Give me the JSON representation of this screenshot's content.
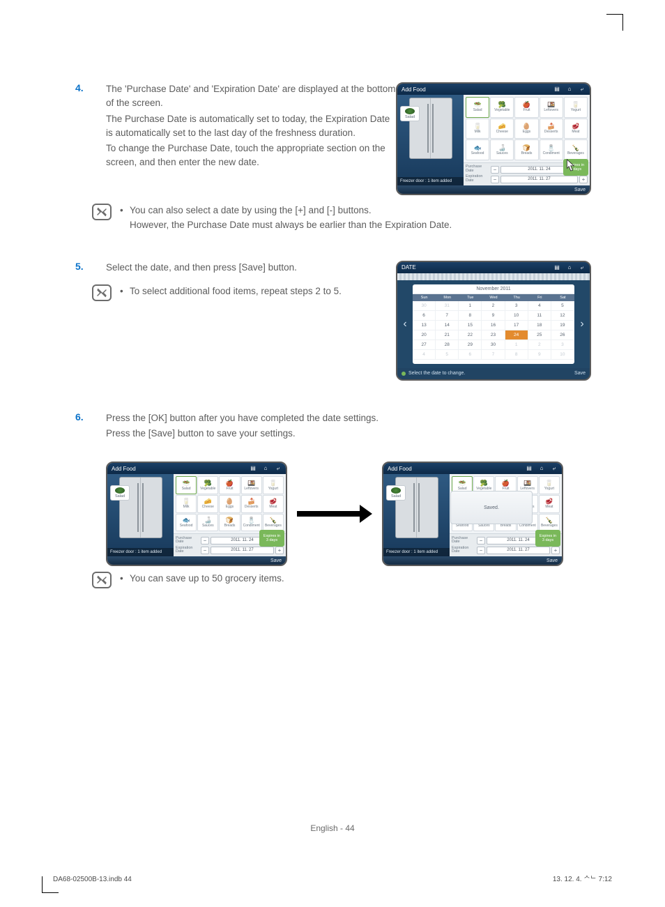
{
  "steps": {
    "s4_num": "4.",
    "s4_p1": "The 'Purchase Date' and 'Expiration Date' are displayed at the bottom of the screen.",
    "s4_p2": "The Purchase Date is automatically set to today, the Expiration Date is automatically set to the last day of the freshness duration.",
    "s4_p3": "To change the Purchase Date, touch the appropriate section on the screen, and then enter the new date.",
    "s5_num": "5.",
    "s5_p1": "Select the date, and then press [Save] button.",
    "s5_note": "To select additional food items, repeat steps 2 to 5.",
    "s6_num": "6.",
    "s6_p1": "Press the [OK] button after you have completed the date settings.",
    "s6_p2": "Press the [Save] button to save your settings."
  },
  "notes": {
    "after4_l1": "You can also select a date by using the [+] and [-] buttons.",
    "after4_l2": "However, the Purchase Date must always be earlier than the Expiration Date.",
    "after6": "You can save up to 50 grocery items."
  },
  "addfood": {
    "title": "Add Food",
    "chip": "Salad",
    "caption": "Freezer door : 1 item added",
    "purchase_lbl": "Purchase\nDate",
    "expiration_lbl": "Expiration\nDate",
    "purchase_val": "2011. 11. 24",
    "expiration_val": "2011. 11. 27",
    "expire_badge": "Expires in\n3 days",
    "save": "Save",
    "saved": "Saved.",
    "categories": [
      {
        "e": "🥗",
        "n": "Salad"
      },
      {
        "e": "🥦",
        "n": "Vegetable"
      },
      {
        "e": "🍎",
        "n": "Fruit"
      },
      {
        "e": "🍱",
        "n": "Leftovers"
      },
      {
        "e": "🥛",
        "n": "Yogurt"
      },
      {
        "e": "🥛",
        "n": "Milk"
      },
      {
        "e": "🧀",
        "n": "Cheese"
      },
      {
        "e": "🥚",
        "n": "Eggs"
      },
      {
        "e": "🍰",
        "n": "Desserts"
      },
      {
        "e": "🥩",
        "n": "Meat"
      },
      {
        "e": "🐟",
        "n": "Seafood"
      },
      {
        "e": "🍶",
        "n": "Sauces"
      },
      {
        "e": "🍞",
        "n": "Breads"
      },
      {
        "e": "🧂",
        "n": "Condiment"
      },
      {
        "e": "🍾",
        "n": "Beverages"
      }
    ]
  },
  "datepanel": {
    "title": "DATE",
    "month": "November 2011",
    "save": "Save",
    "hint": "Select the date to change.",
    "dow": [
      "Sun",
      "Mon",
      "Tue",
      "Wed",
      "Thu",
      "Fri",
      "Sat"
    ],
    "rows": [
      [
        {
          "n": "30",
          "m": 1
        },
        {
          "n": "31",
          "m": 1
        },
        {
          "n": "1"
        },
        {
          "n": "2"
        },
        {
          "n": "3"
        },
        {
          "n": "4"
        },
        {
          "n": "5"
        }
      ],
      [
        {
          "n": "6"
        },
        {
          "n": "7"
        },
        {
          "n": "8"
        },
        {
          "n": "9"
        },
        {
          "n": "10"
        },
        {
          "n": "11"
        },
        {
          "n": "12"
        }
      ],
      [
        {
          "n": "13"
        },
        {
          "n": "14"
        },
        {
          "n": "15"
        },
        {
          "n": "16"
        },
        {
          "n": "17"
        },
        {
          "n": "18"
        },
        {
          "n": "19"
        }
      ],
      [
        {
          "n": "20"
        },
        {
          "n": "21"
        },
        {
          "n": "22"
        },
        {
          "n": "23"
        },
        {
          "n": "24",
          "s": 1
        },
        {
          "n": "25"
        },
        {
          "n": "26"
        }
      ],
      [
        {
          "n": "27"
        },
        {
          "n": "28"
        },
        {
          "n": "29"
        },
        {
          "n": "30"
        },
        {
          "n": "1",
          "m": 1
        },
        {
          "n": "2",
          "m": 1
        },
        {
          "n": "3",
          "m": 1
        }
      ],
      [
        {
          "n": "4",
          "m": 1
        },
        {
          "n": "5",
          "m": 1
        },
        {
          "n": "6",
          "m": 1
        },
        {
          "n": "7",
          "m": 1
        },
        {
          "n": "8",
          "m": 1
        },
        {
          "n": "9",
          "m": 1
        },
        {
          "n": "10",
          "m": 1
        }
      ]
    ]
  },
  "footer": {
    "page": "English - 44",
    "indb": "DA68-02500B-13.indb   44",
    "time": "13. 12. 4.   ᄉᄂ 7:12"
  }
}
